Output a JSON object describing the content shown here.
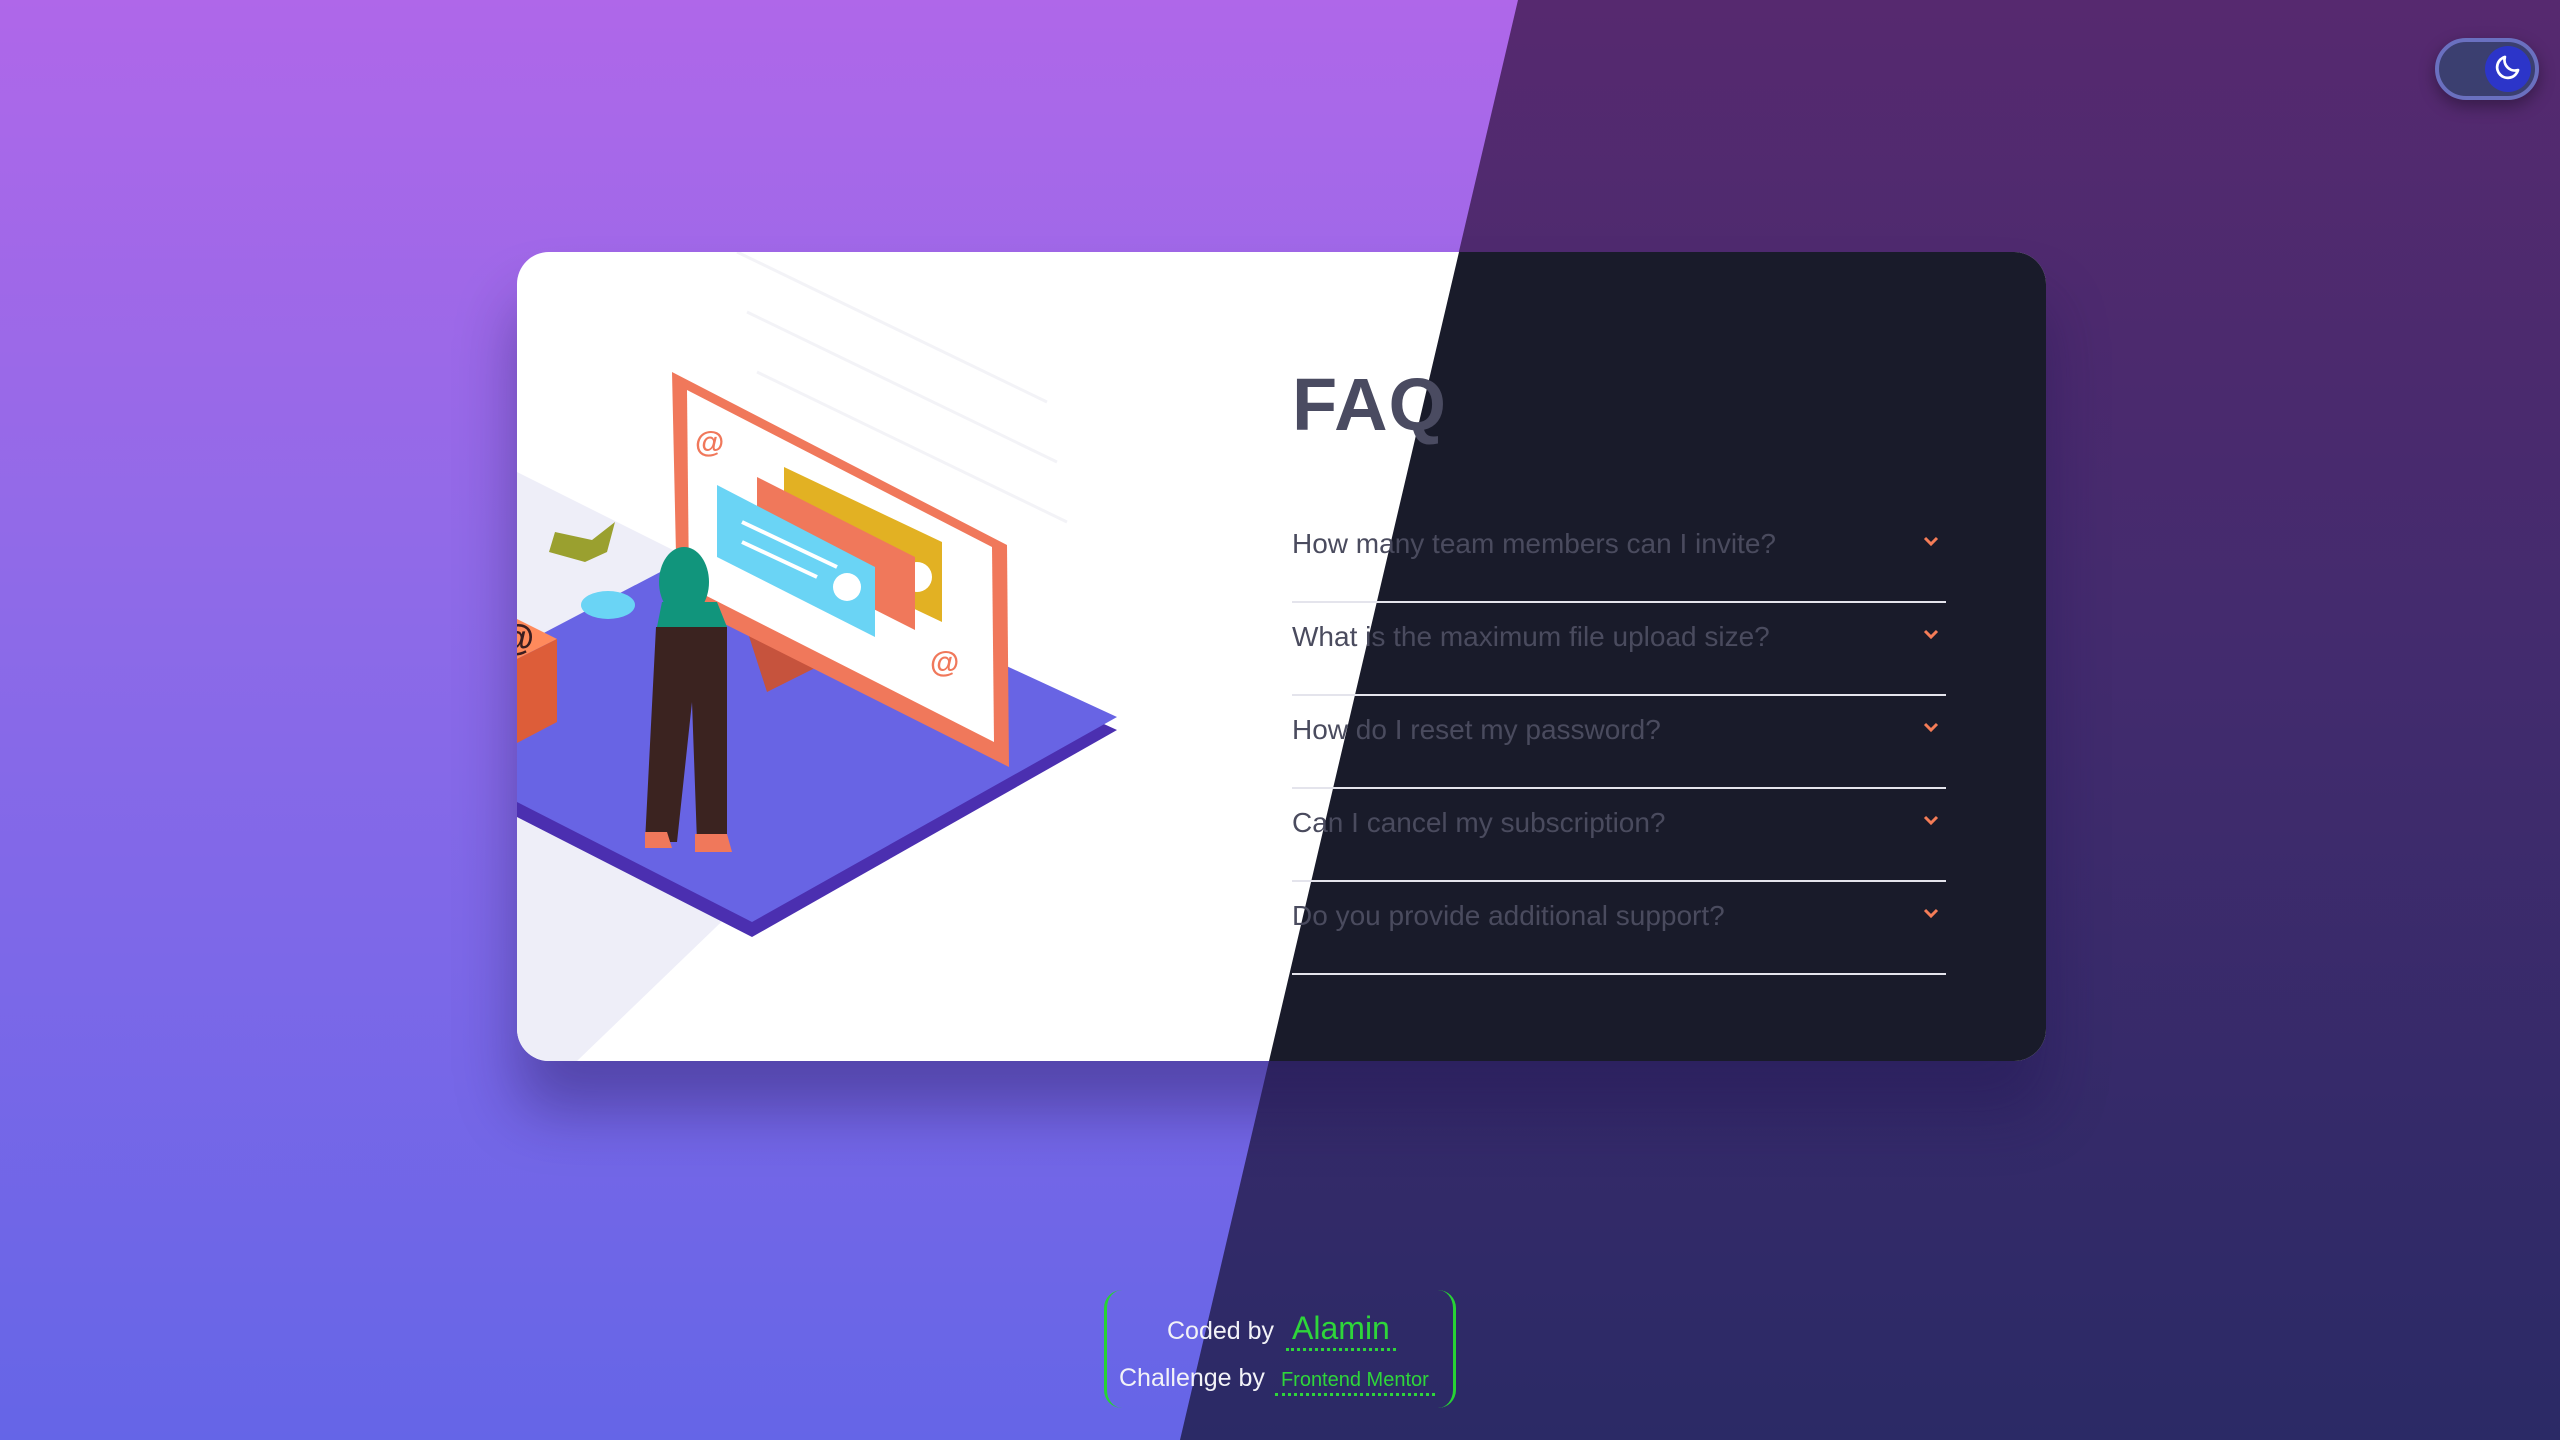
{
  "page": {
    "title": "FAQ"
  },
  "faq": {
    "items": [
      {
        "question": "How many team members can I invite?"
      },
      {
        "question": "What is the maximum file upload size?"
      },
      {
        "question": "How do I reset my password?"
      },
      {
        "question": "Can I cancel my subscription?"
      },
      {
        "question": "Do you provide additional support?"
      }
    ]
  },
  "theme_toggle": {
    "icon": "moon-icon",
    "mode": "dark"
  },
  "credit": {
    "coded_by_label": "Coded by",
    "author": "Alamin",
    "challenge_label": "Challenge by",
    "challenge_source": "Frontend Mentor"
  },
  "colors": {
    "accent": "#f47c57",
    "title": "#4a4b61",
    "card_dark": "#191b2a",
    "link": "#2ed63a",
    "bg_light_top": "#af67e9",
    "bg_light_bottom": "#6565e7"
  }
}
